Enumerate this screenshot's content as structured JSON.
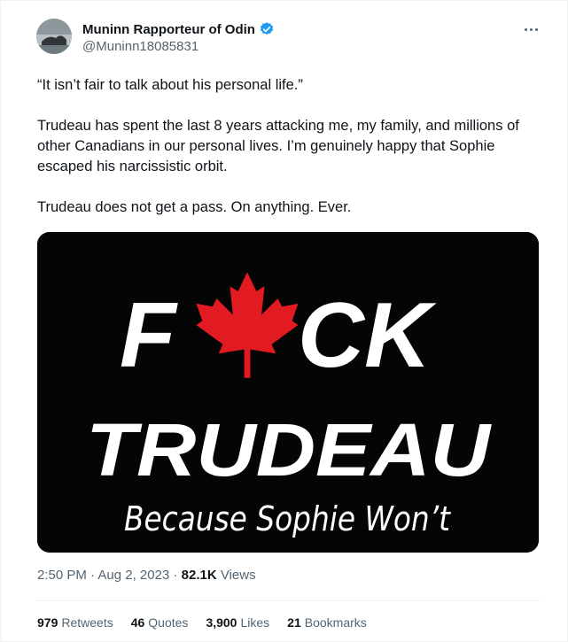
{
  "author": {
    "name": "Muninn Rapporteur of Odin",
    "handle": "@Muninn18085831",
    "verified_color": "#1d9bf0"
  },
  "tweet": {
    "quote": "“It isn’t fair to talk about his personal life.”",
    "paragraph2": "Trudeau has spent the last 8 years attacking me, my family, and millions of other Canadians in our personal lives. I’m genuinely happy that Sophie escaped his narcissistic orbit.",
    "paragraph3": "Trudeau does not get a pass. On anything. Ever."
  },
  "media": {
    "line1_left": "F",
    "line1_right": "CK",
    "line2": "TRUDEAU",
    "line3": "Because Sophie Won’t",
    "leaf_color": "#e21b23",
    "background": "#050505"
  },
  "meta": {
    "time": "2:50 PM",
    "separator": "·",
    "date": "Aug 2, 2023",
    "views_count": "82.1K",
    "views_label": "Views"
  },
  "stats": {
    "retweets_count": "979",
    "retweets_label": "Retweets",
    "quotes_count": "46",
    "quotes_label": "Quotes",
    "likes_count": "3,900",
    "likes_label": "Likes",
    "bookmarks_count": "21",
    "bookmarks_label": "Bookmarks"
  }
}
